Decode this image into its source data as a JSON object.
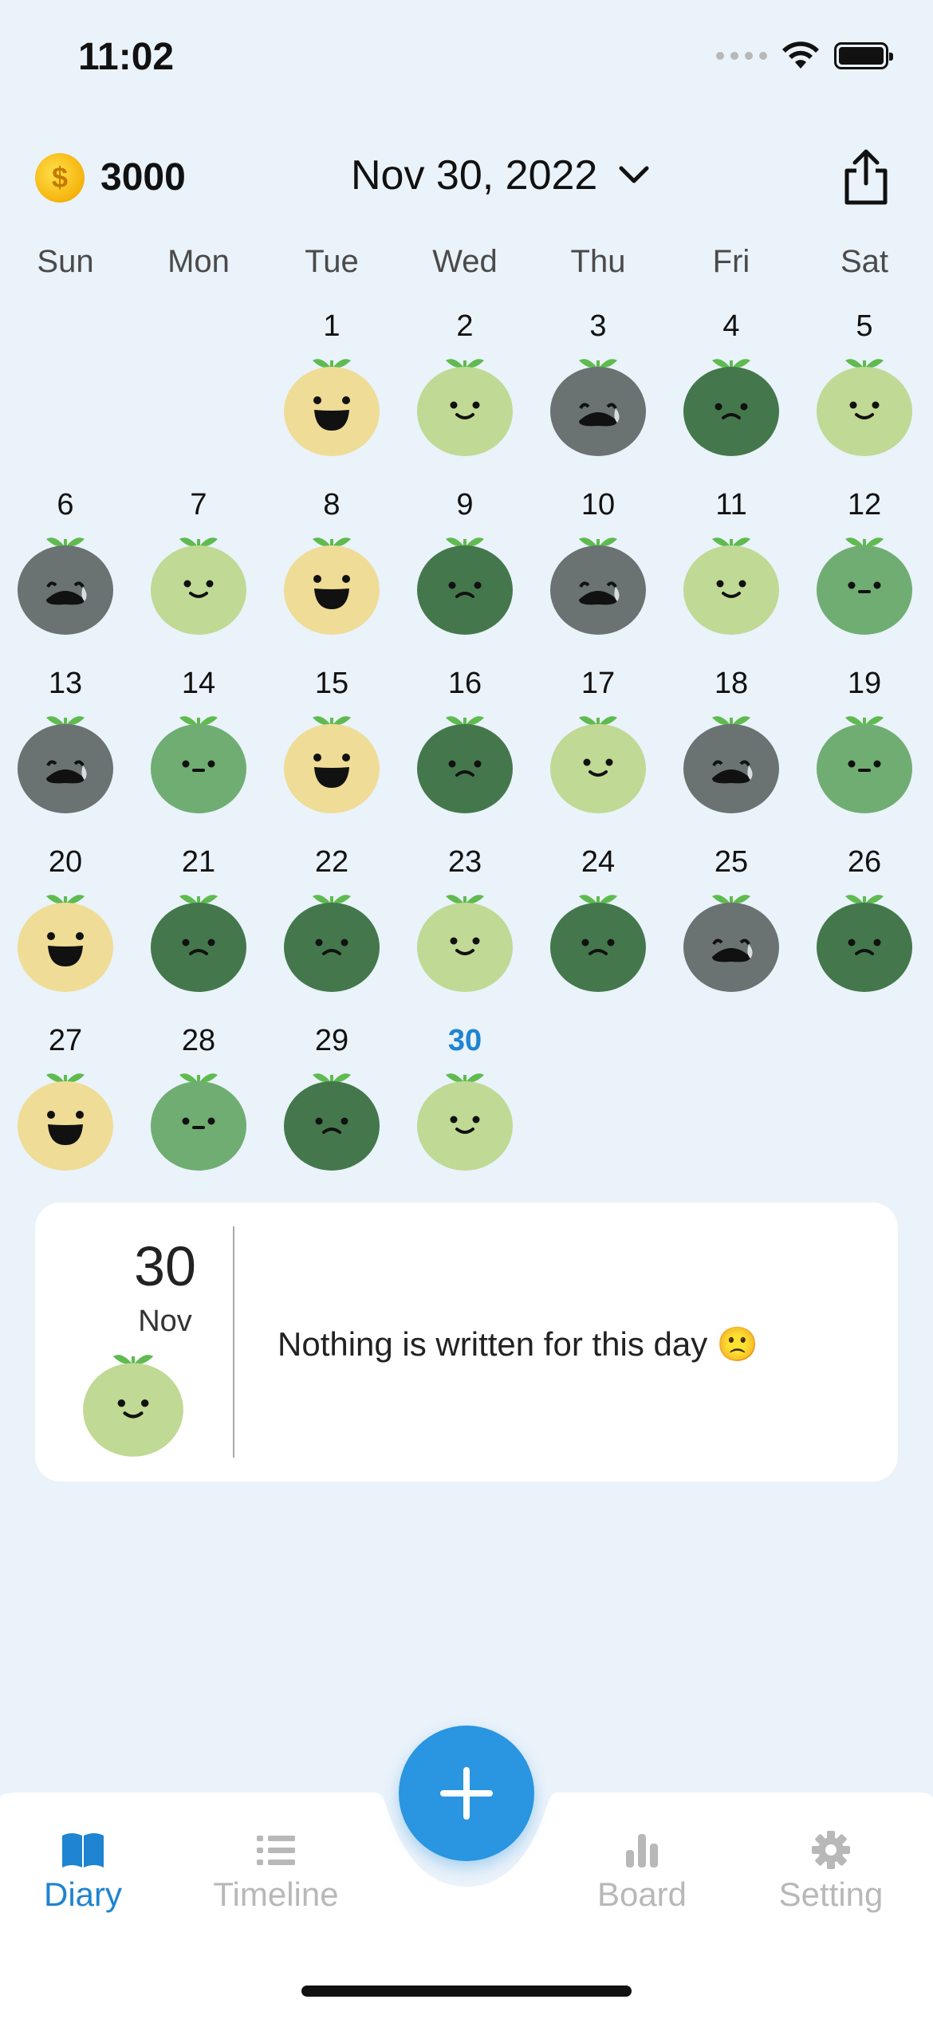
{
  "status_bar": {
    "time": "11:02"
  },
  "header": {
    "coins": "3000",
    "date_label": "Nov 30, 2022"
  },
  "weekdays": [
    "Sun",
    "Mon",
    "Tue",
    "Wed",
    "Thu",
    "Fri",
    "Sat"
  ],
  "mood_colors": {
    "happy": "#efdc96",
    "smile": "#c0d994",
    "neutral": "#70ad72",
    "sad": "#44784c",
    "crying": "#6a7372",
    "leaf": "#5fbb50"
  },
  "calendar": {
    "days": [
      {
        "day": "1",
        "mood": "happy"
      },
      {
        "day": "2",
        "mood": "smile"
      },
      {
        "day": "3",
        "mood": "crying"
      },
      {
        "day": "4",
        "mood": "sad"
      },
      {
        "day": "5",
        "mood": "smile"
      },
      {
        "day": "6",
        "mood": "crying"
      },
      {
        "day": "7",
        "mood": "smile"
      },
      {
        "day": "8",
        "mood": "happy"
      },
      {
        "day": "9",
        "mood": "sad"
      },
      {
        "day": "10",
        "mood": "crying"
      },
      {
        "day": "11",
        "mood": "smile"
      },
      {
        "day": "12",
        "mood": "neutral"
      },
      {
        "day": "13",
        "mood": "crying"
      },
      {
        "day": "14",
        "mood": "neutral"
      },
      {
        "day": "15",
        "mood": "happy"
      },
      {
        "day": "16",
        "mood": "sad"
      },
      {
        "day": "17",
        "mood": "smile"
      },
      {
        "day": "18",
        "mood": "crying"
      },
      {
        "day": "19",
        "mood": "neutral"
      },
      {
        "day": "20",
        "mood": "happy"
      },
      {
        "day": "21",
        "mood": "sad"
      },
      {
        "day": "22",
        "mood": "sad"
      },
      {
        "day": "23",
        "mood": "smile"
      },
      {
        "day": "24",
        "mood": "sad"
      },
      {
        "day": "25",
        "mood": "crying"
      },
      {
        "day": "26",
        "mood": "sad"
      },
      {
        "day": "27",
        "mood": "happy"
      },
      {
        "day": "28",
        "mood": "neutral"
      },
      {
        "day": "29",
        "mood": "sad"
      },
      {
        "day": "30",
        "mood": "smile",
        "today": true
      }
    ]
  },
  "entry": {
    "day": "30",
    "month": "Nov",
    "mood": "smile",
    "text": "Nothing is written for this day 🙁"
  },
  "nav": {
    "diary": "Diary",
    "timeline": "Timeline",
    "board": "Board",
    "setting": "Setting"
  },
  "accent_color": "#1f84d1"
}
